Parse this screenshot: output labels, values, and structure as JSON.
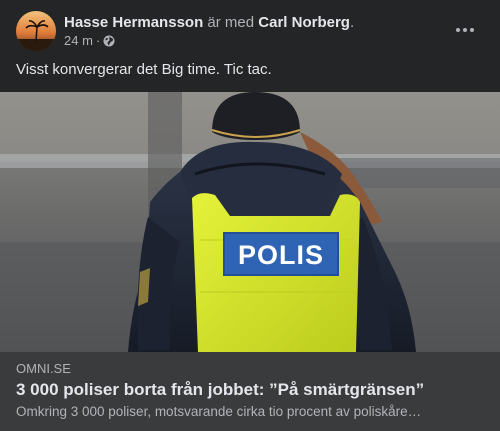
{
  "post": {
    "author": "Hasse Hermansson",
    "with_text": "är med",
    "tagged": "Carl Norberg",
    "period": ".",
    "time": "24 m",
    "separator": "·",
    "privacy_icon": "globe-icon",
    "more_icon": "more-options-icon",
    "text": "Visst konvergerar det Big time. Tic tac."
  },
  "photo": {
    "vest_text": "POLIS"
  },
  "link": {
    "domain": "OMNI.SE",
    "title": "3 000 poliser borta från jobbet: ”På smärtgränsen”",
    "description": "Omkring 3 000 poliser, motsvarande cirka tio procent av poliskåre…"
  },
  "colors": {
    "background": "#242526",
    "card": "#3a3b3c",
    "primary_text": "#e4e6eb",
    "secondary_text": "#b0b3b8",
    "vest": "#d8ea2c",
    "polis_badge": "#2f63b4"
  }
}
